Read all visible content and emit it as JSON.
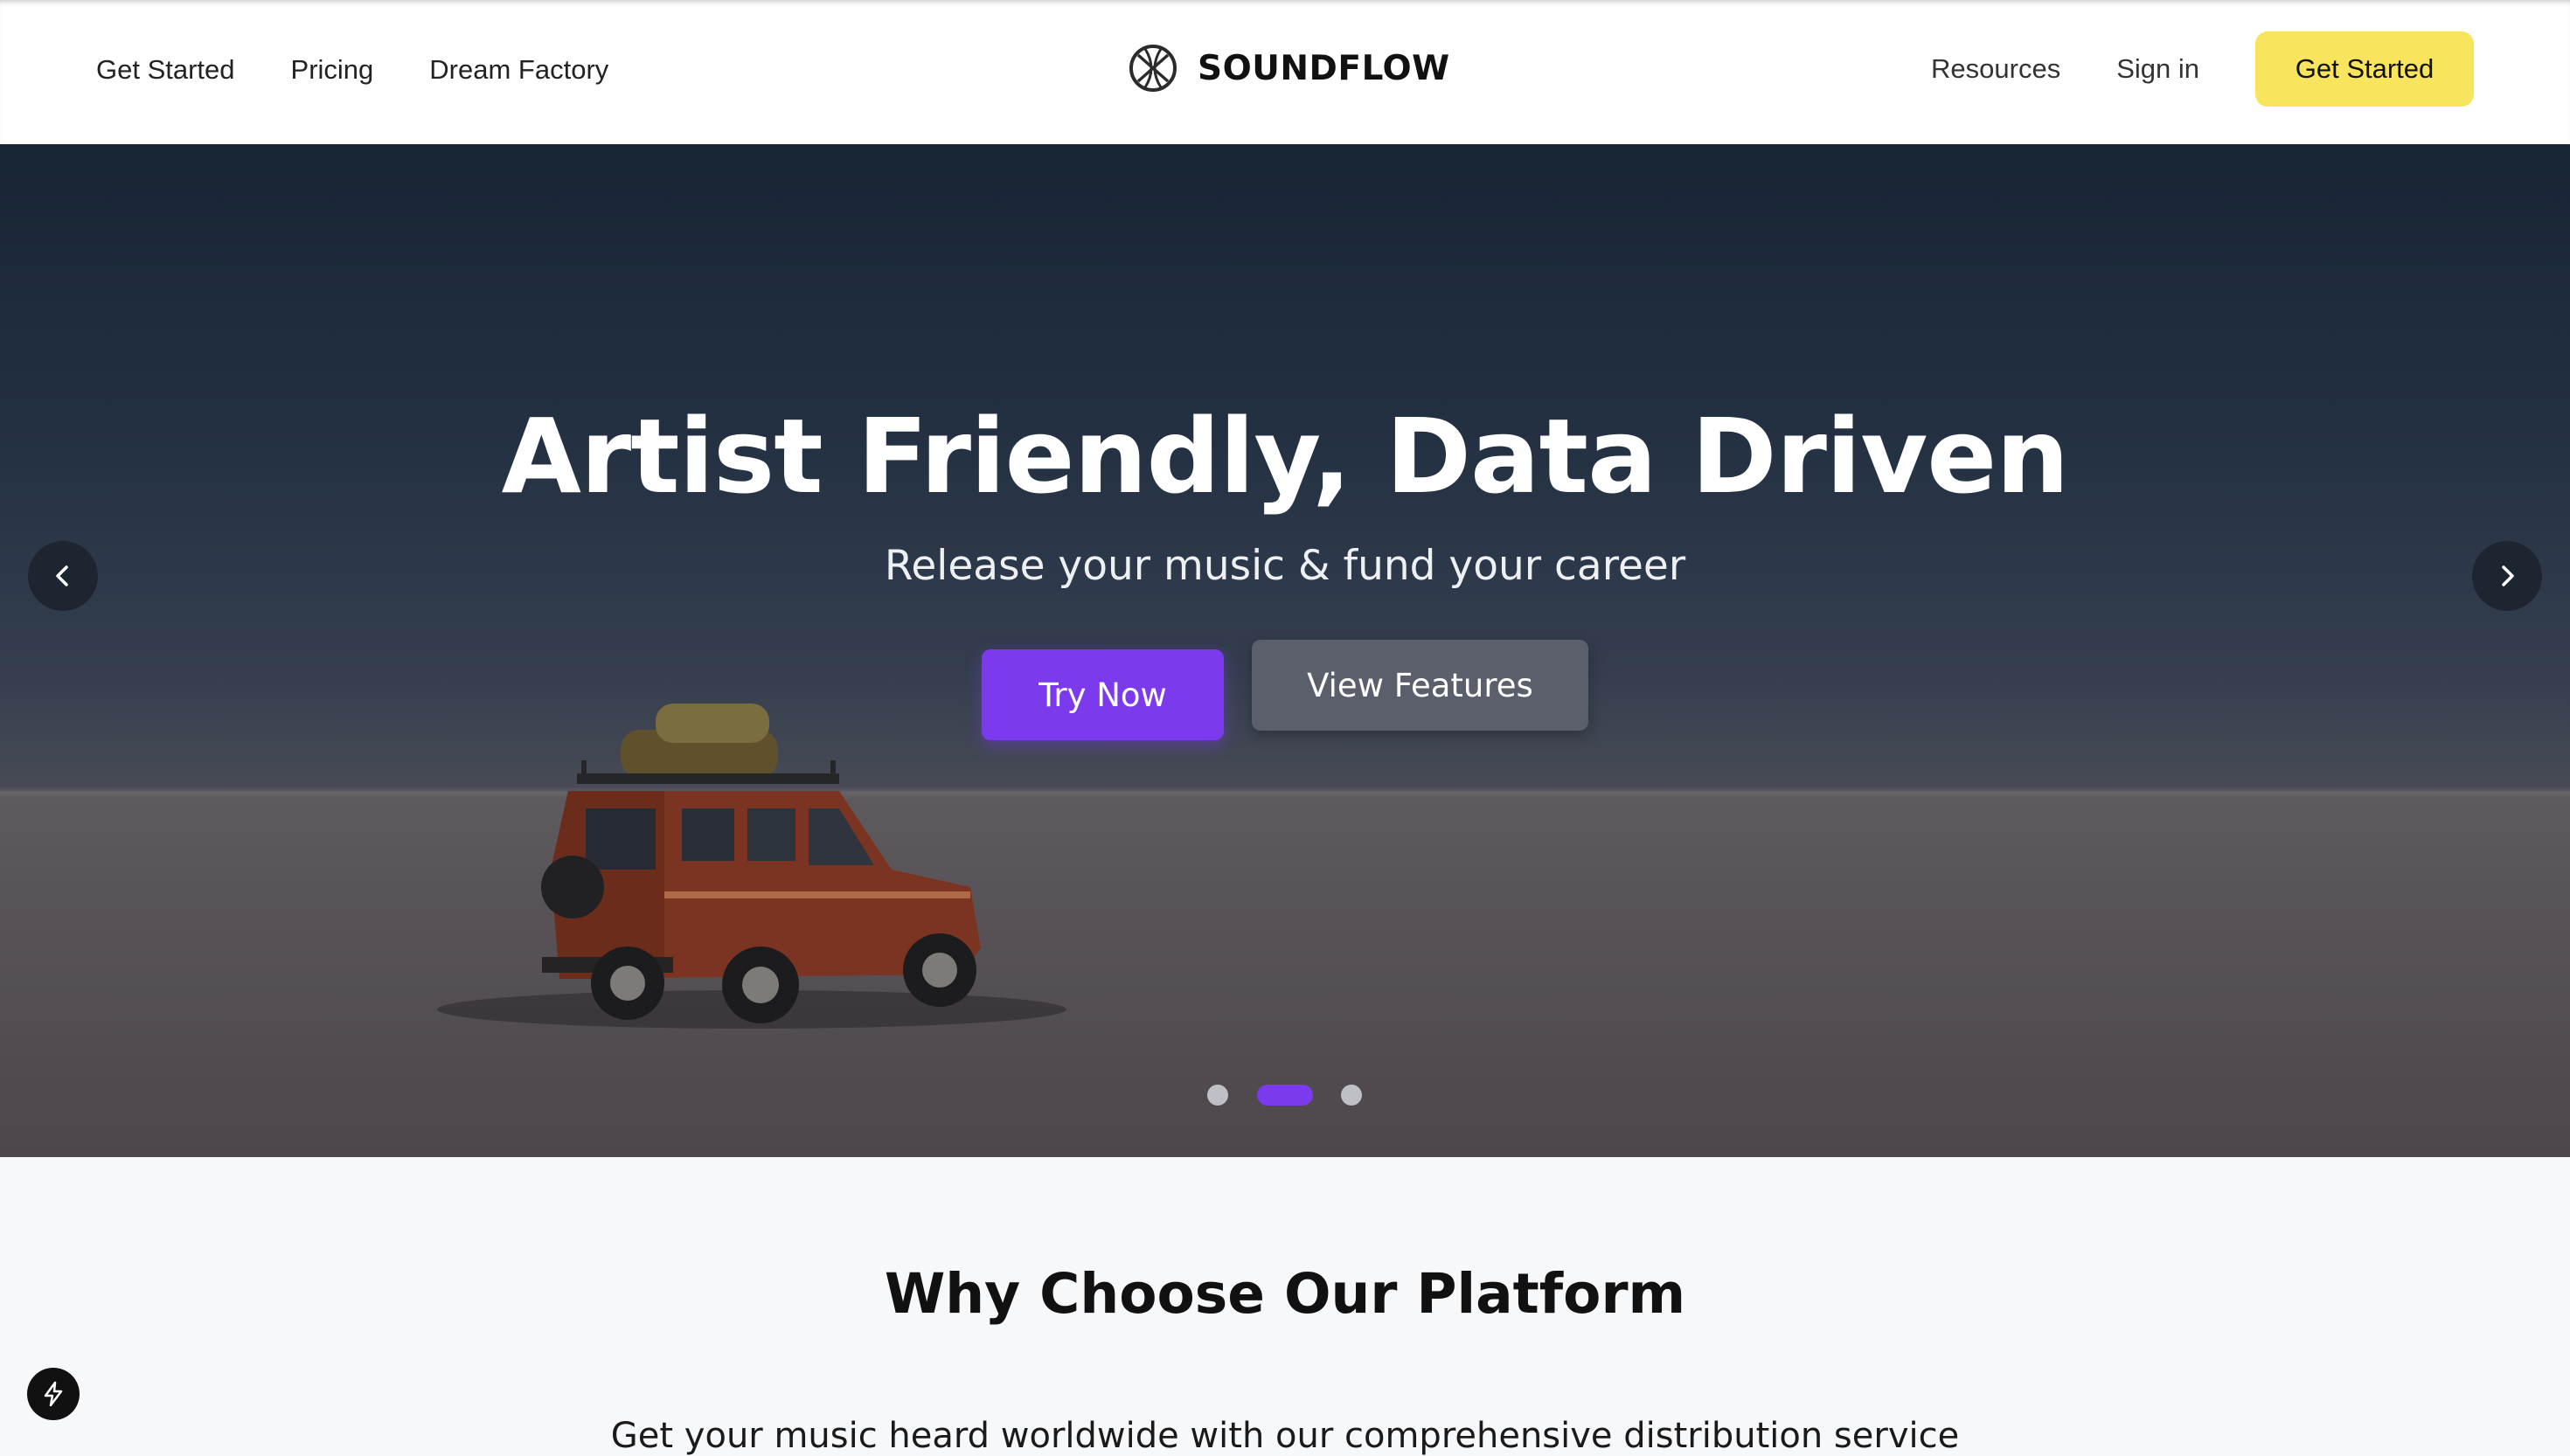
{
  "header": {
    "nav_left": [
      "Get Started",
      "Pricing",
      "Dream Factory"
    ],
    "brand_name": "SOUNDFLOW",
    "nav_right": [
      "Resources",
      "Sign in"
    ],
    "cta_label": "Get Started"
  },
  "hero": {
    "title": "Artist Friendly, Data Driven",
    "subtitle": "Release your music & fund your career",
    "primary_button": "Try Now",
    "secondary_button": "View Features",
    "active_slide": 2,
    "slide_count": 3
  },
  "features": {
    "title": "Why Choose Our Platform",
    "description": "Get your music heard worldwide with our comprehensive distribution service"
  },
  "icons": {
    "brand": "globe-logo-icon",
    "prev": "chevron-left-icon",
    "next": "chevron-right-icon",
    "fab": "lightning-bolt-icon"
  },
  "colors": {
    "accent": "#7c3aed",
    "cta": "#f8e45d",
    "secondary_button": "#5b5f6b"
  }
}
